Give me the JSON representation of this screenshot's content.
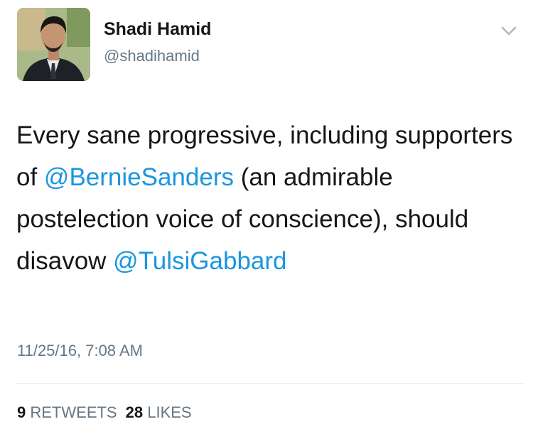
{
  "author": {
    "name": "Shadi Hamid",
    "handle": "@shadihamid"
  },
  "tweet": {
    "text_part1": "Every sane progressive, including supporters of ",
    "mention1": "@BernieSanders",
    "text_part2": " (an admirable postelection voice of conscience), should disavow ",
    "mention2": "@TulsiGabbard"
  },
  "timestamp": "11/25/16, 7:08 AM",
  "stats": {
    "retweets_count": "9",
    "retweets_label": "RETWEETS",
    "likes_count": "28",
    "likes_label": "LIKES"
  },
  "colors": {
    "mention": "#1b95e0",
    "secondary_text": "#657786",
    "divider": "#e1e8ed"
  },
  "icons": {
    "menu": "chevron-down-icon"
  }
}
